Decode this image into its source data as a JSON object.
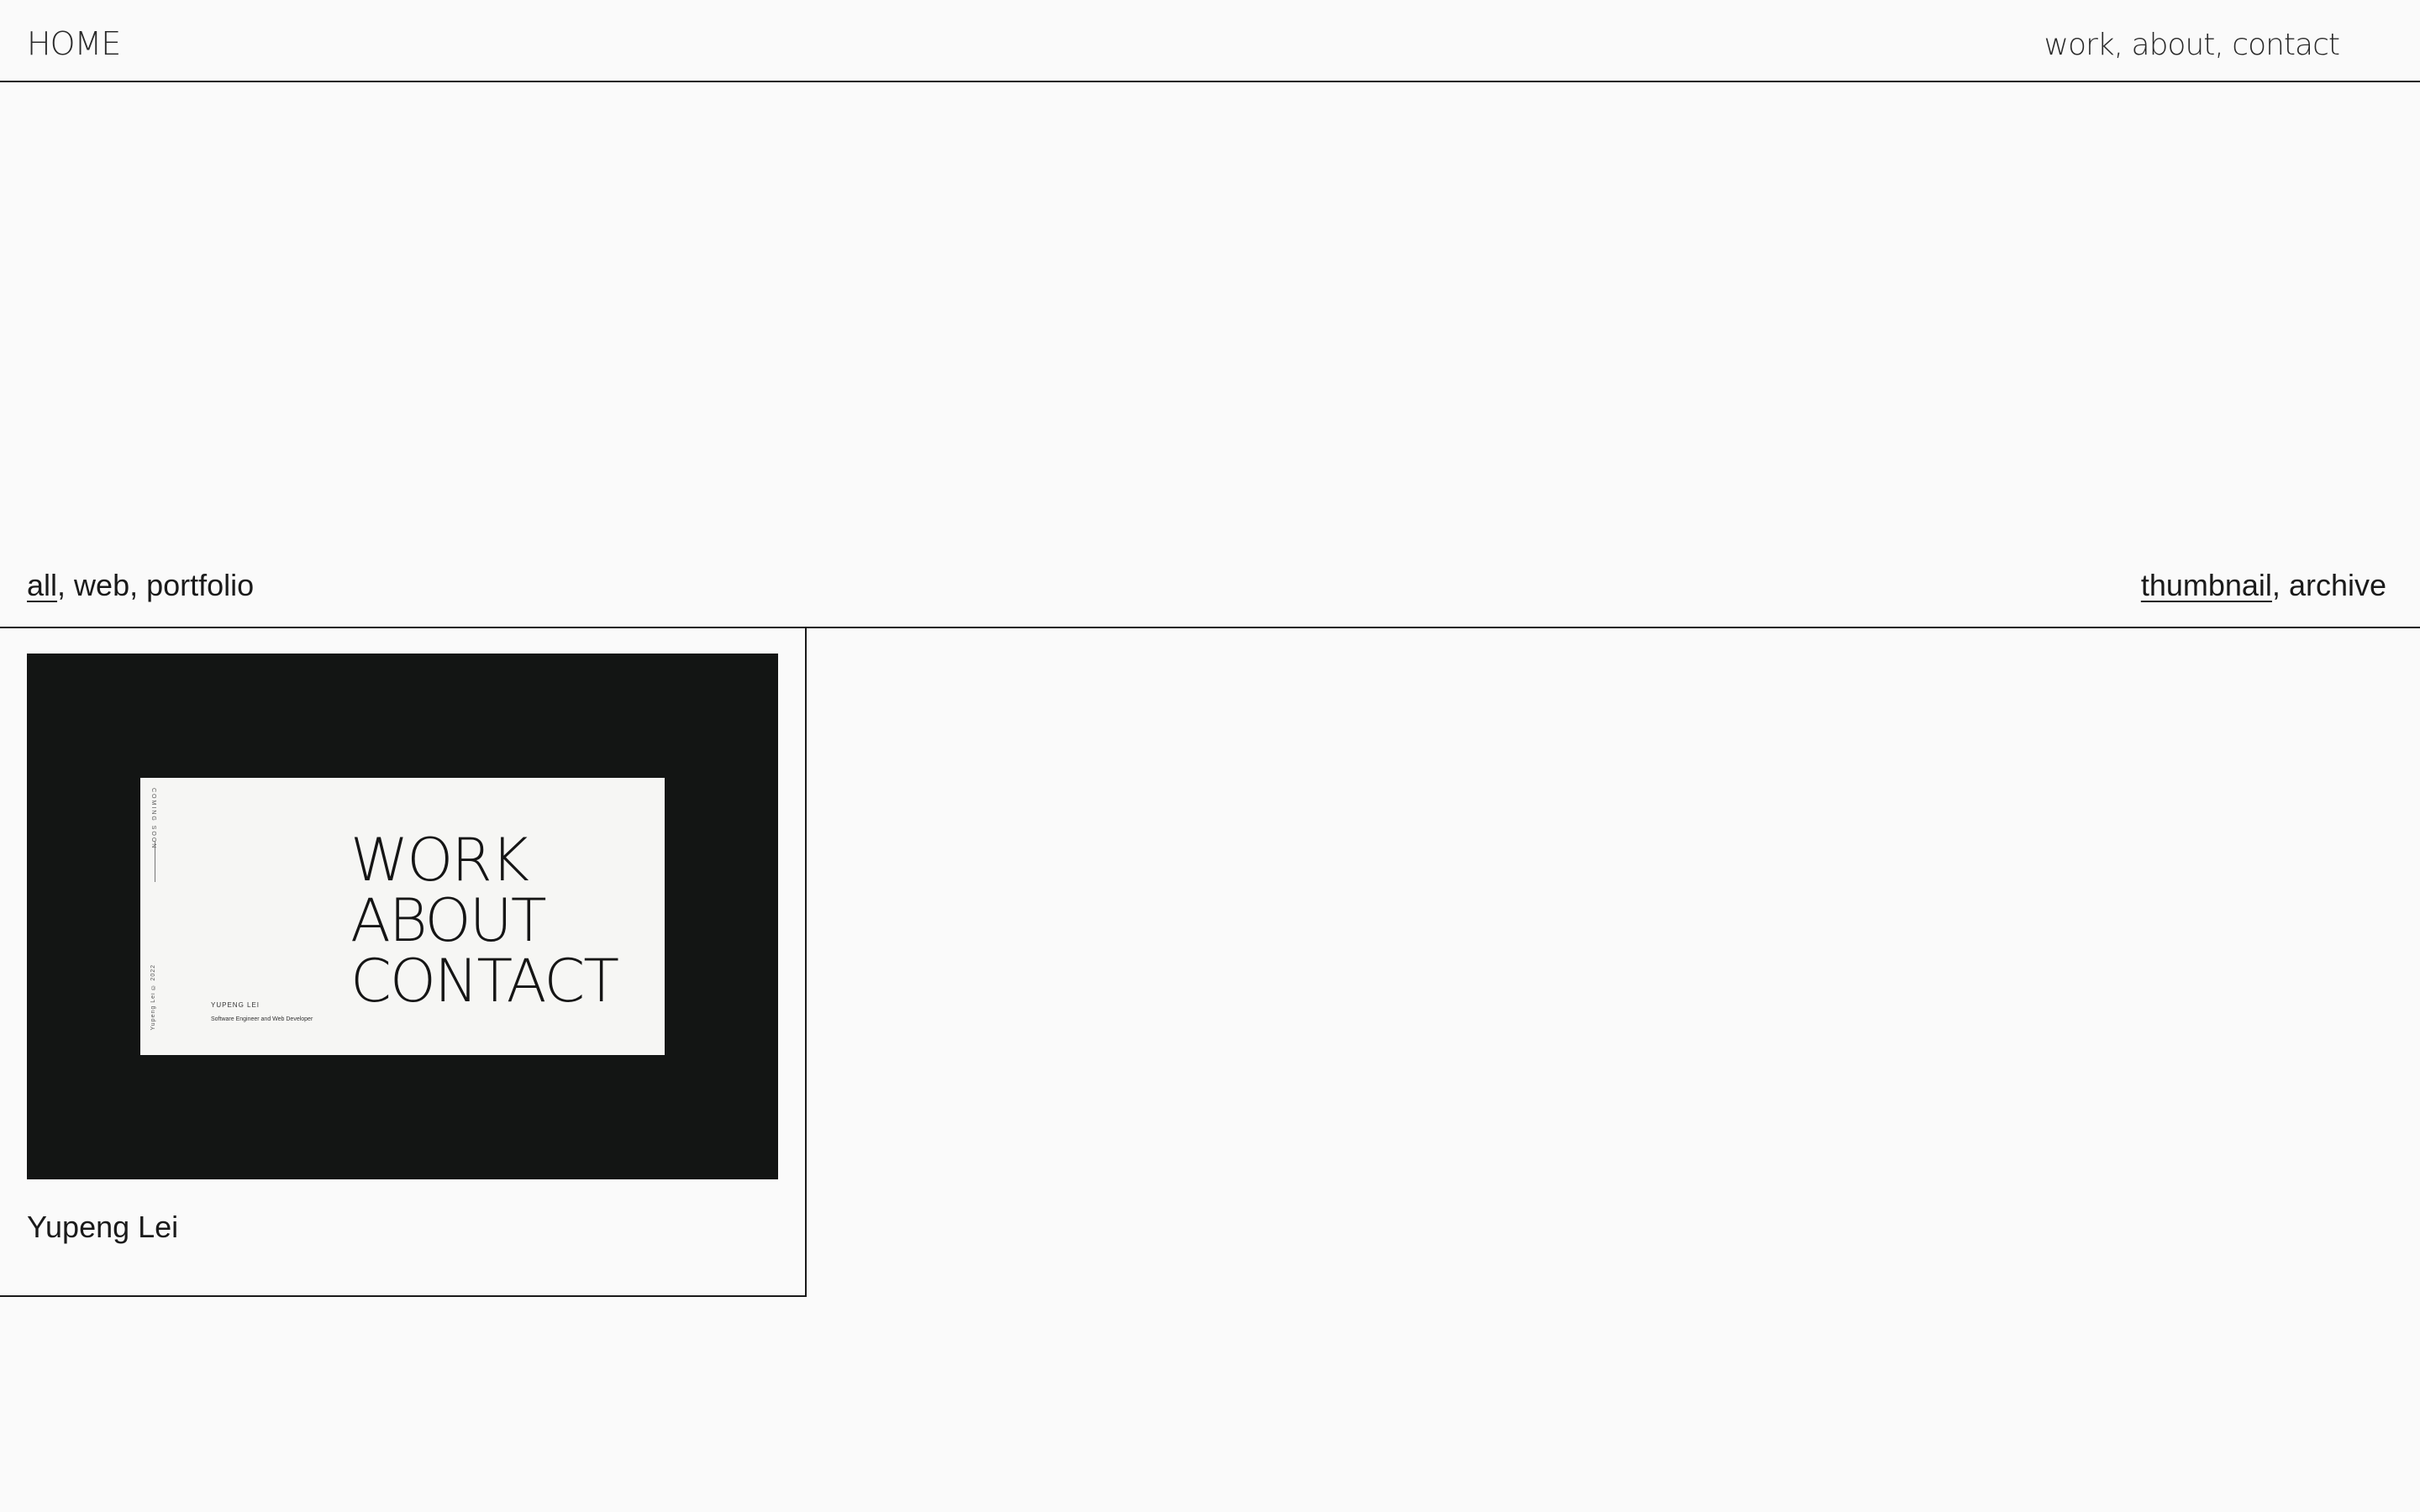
{
  "header": {
    "home_label": "HOME",
    "nav": {
      "work": "work",
      "about": "about",
      "contact": "contact",
      "separator": ", "
    }
  },
  "filters": {
    "categories": {
      "all": "all",
      "web": "web",
      "portfolio": "portfolio",
      "active": "all"
    },
    "views": {
      "thumbnail": "thumbnail",
      "archive": "archive",
      "active": "thumbnail"
    },
    "separator": ", "
  },
  "projects": [
    {
      "title": "Yupeng Lei",
      "thumbnail": {
        "menu": [
          "WORK",
          "ABOUT",
          "CONTACT"
        ],
        "name": "YUPENG LEI",
        "role": "Software Engineer and Web Developer",
        "vertical_top": "COMING SOON",
        "vertical_bottom": "Yupeng Lei © 2022"
      }
    }
  ],
  "colors": {
    "background": "#fafafa",
    "text": "#1a1a1a",
    "thumbnail_bg": "#131514",
    "mock_page_bg": "#f6f6f4"
  }
}
